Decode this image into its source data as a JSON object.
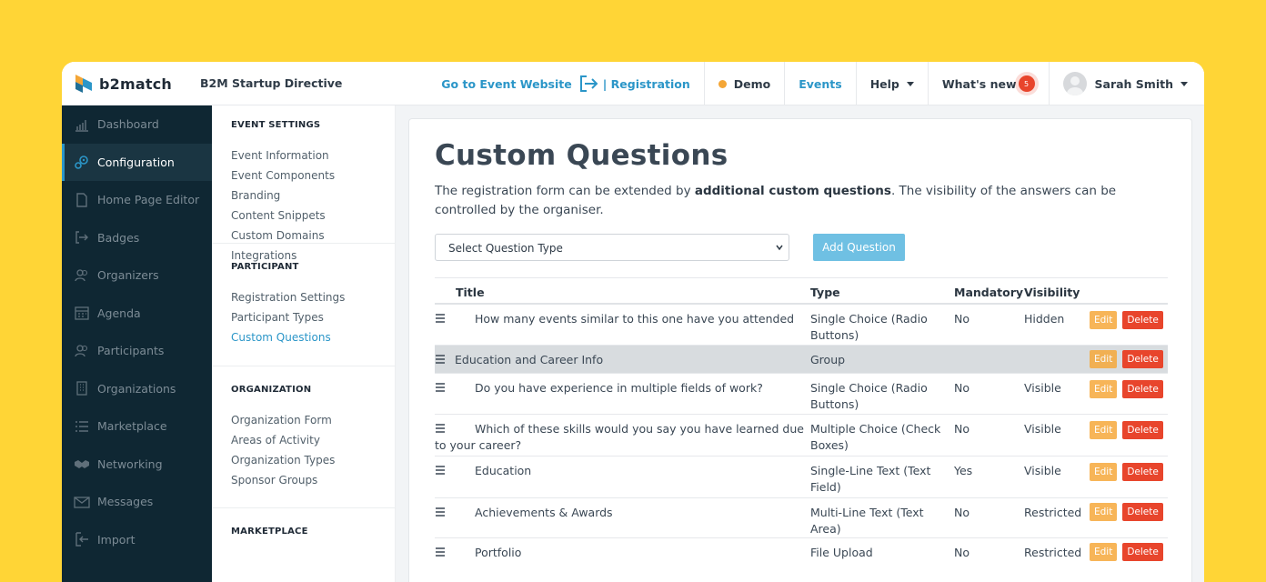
{
  "brand": {
    "logo_text": "b2match",
    "event_name": "B2M Startup Directive"
  },
  "topnav": {
    "website_link": "Go to Event Website",
    "registration_link": "| Registration",
    "demo_label": "Demo",
    "events_label": "Events",
    "help_label": "Help",
    "whats_new_label": "What's new",
    "whats_new_count": "5",
    "user_name": "Sarah Smith"
  },
  "sidebar": {
    "items": [
      {
        "label": "Dashboard",
        "icon": "chart-icon"
      },
      {
        "label": "Configuration",
        "icon": "gears-icon",
        "active": true
      },
      {
        "label": "Home Page Editor",
        "icon": "page-icon"
      },
      {
        "label": "Badges",
        "icon": "badge-icon"
      },
      {
        "label": "Organizers",
        "icon": "people-icon"
      },
      {
        "label": "Agenda",
        "icon": "calendar-icon"
      },
      {
        "label": "Participants",
        "icon": "people-icon"
      },
      {
        "label": "Organizations",
        "icon": "building-icon"
      },
      {
        "label": "Marketplace",
        "icon": "list-icon"
      },
      {
        "label": "Networking",
        "icon": "handshake-icon"
      },
      {
        "label": "Messages",
        "icon": "envelope-icon"
      },
      {
        "label": "Import",
        "icon": "import-icon"
      }
    ]
  },
  "settings": {
    "event_settings": {
      "title": "EVENT SETTINGS",
      "links": [
        "Event Information",
        "Event Components",
        "Branding",
        "Content Snippets",
        "Custom Domains",
        "Integrations"
      ]
    },
    "participant": {
      "title": "PARTICIPANT",
      "links": [
        "Registration Settings",
        "Participant Types",
        "Custom Questions"
      ]
    },
    "organization": {
      "title": "ORGANIZATION",
      "links": [
        "Organization Form",
        "Areas of Activity",
        "Organization Types",
        "Sponsor Groups"
      ]
    },
    "marketplace": {
      "title": "MARKETPLACE"
    }
  },
  "main": {
    "title": "Custom Questions",
    "desc_pre": "The registration form can be extended by ",
    "desc_bold": "additional custom questions",
    "desc_post": ". The visibility of the answers can be controlled by the organiser.",
    "select_placeholder": "Select Question Type",
    "add_button": "Add Question",
    "columns": [
      "Title",
      "Type",
      "Mandatory",
      "Visibility"
    ],
    "edit_label": "Edit",
    "delete_label": "Delete",
    "rows": [
      {
        "title": "How many events similar to this one have you attended",
        "type": "Single Choice (Radio Buttons)",
        "mandatory": "No",
        "visibility": "Hidden"
      },
      {
        "title": "Education and Career Info",
        "type": "Group",
        "mandatory": "",
        "visibility": "",
        "group": true
      },
      {
        "title": "Do you have experience in multiple fields of work?",
        "type": "Single Choice (Radio Buttons)",
        "mandatory": "No",
        "visibility": "Visible"
      },
      {
        "title": "Which of these skills would you say you have learned due to your career?",
        "type": "Multiple Choice (Check Boxes)",
        "mandatory": "No",
        "visibility": "Visible"
      },
      {
        "title": "Education",
        "type": "Single-Line Text (Text Field)",
        "mandatory": "Yes",
        "visibility": "Visible"
      },
      {
        "title": "Achievements & Awards",
        "type": "Multi-Line Text (Text Area)",
        "mandatory": "No",
        "visibility": "Restricted"
      },
      {
        "title": "Portfolio",
        "type": "File Upload",
        "mandatory": "No",
        "visibility": "Restricted"
      }
    ]
  },
  "colors": {
    "accent": "#2b96c8",
    "sidebar_bg": "#0f2733",
    "page_bg": "#FFD536",
    "edit": "#f6a93b",
    "delete": "#e8452c"
  }
}
